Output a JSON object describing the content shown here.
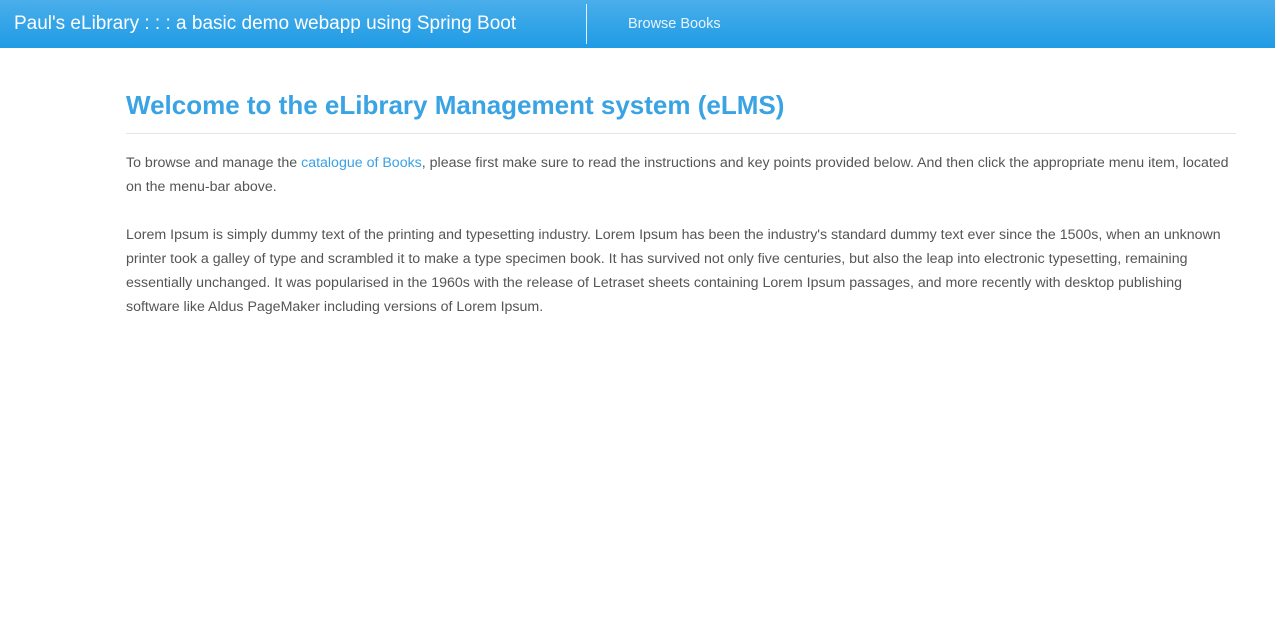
{
  "navbar": {
    "brand": "Paul's eLibrary : : : a basic demo webapp using Spring Boot",
    "links": [
      {
        "label": "Browse Books"
      }
    ],
    "color": "#2ca3e8"
  },
  "main": {
    "title": "Welcome to the eLibrary Management system (eLMS)",
    "intro": {
      "before": "To browse and manage the ",
      "link": "catalogue of Books",
      "after": ", please first make sure to read the instructions and key points provided below. And then click the appropriate menu item, located on the menu-bar above."
    },
    "lorem": "Lorem Ipsum is simply dummy text of the printing and typesetting industry. Lorem Ipsum has been the industry's standard dummy text ever since the 1500s, when an unknown printer took a galley of type and scrambled it to make a type specimen book. It has survived not only five centuries, but also the leap into electronic typesetting, remaining essentially unchanged. It was popularised in the 1960s with the release of Letraset sheets containing Lorem Ipsum passages, and more recently with desktop publishing software like Aldus PageMaker including versions of Lorem Ipsum."
  }
}
